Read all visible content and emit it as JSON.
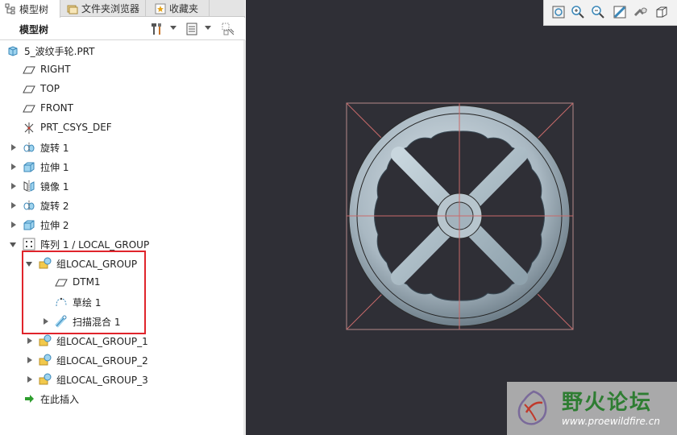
{
  "tabs": [
    {
      "label": "模型树",
      "icon": "model-tree-icon",
      "active": true
    },
    {
      "label": "文件夹浏览器",
      "icon": "folder-browser-icon",
      "active": false
    },
    {
      "label": "收藏夹",
      "icon": "favorites-icon",
      "active": false
    }
  ],
  "tree_header": {
    "title": "模型树",
    "tools": [
      "settings-icon",
      "show-icon",
      "filter-icon"
    ]
  },
  "tree": [
    {
      "label": "5_波纹手轮.PRT",
      "icon": "part-icon",
      "toggle": "none"
    },
    {
      "label": "RIGHT",
      "icon": "datum-plane-icon",
      "toggle": "none"
    },
    {
      "label": "TOP",
      "icon": "datum-plane-icon",
      "toggle": "none"
    },
    {
      "label": "FRONT",
      "icon": "datum-plane-icon",
      "toggle": "none"
    },
    {
      "label": "PRT_CSYS_DEF",
      "icon": "csys-icon",
      "toggle": "none"
    },
    {
      "label": "旋转 1",
      "icon": "revolve-icon",
      "toggle": "collapsed"
    },
    {
      "label": "拉伸 1",
      "icon": "extrude-icon",
      "toggle": "collapsed"
    },
    {
      "label": "镜像 1",
      "icon": "mirror-icon",
      "toggle": "collapsed"
    },
    {
      "label": "旋转 2",
      "icon": "revolve-icon",
      "toggle": "collapsed"
    },
    {
      "label": "拉伸 2",
      "icon": "extrude-icon",
      "toggle": "collapsed"
    },
    {
      "label": "阵列 1 / LOCAL_GROUP",
      "icon": "pattern-icon",
      "toggle": "expanded"
    },
    {
      "label": "组LOCAL_GROUP",
      "icon": "group-icon",
      "toggle": "expanded"
    },
    {
      "label": "DTM1",
      "icon": "datum-plane-icon",
      "toggle": "none"
    },
    {
      "label": "草绘 1",
      "icon": "sketch-icon",
      "toggle": "none"
    },
    {
      "label": "扫描混合 1",
      "icon": "sweep-blend-icon",
      "toggle": "collapsed"
    },
    {
      "label": "组LOCAL_GROUP_1",
      "icon": "group-icon",
      "toggle": "collapsed"
    },
    {
      "label": "组LOCAL_GROUP_2",
      "icon": "group-icon",
      "toggle": "collapsed"
    },
    {
      "label": "组LOCAL_GROUP_3",
      "icon": "group-icon",
      "toggle": "collapsed"
    },
    {
      "label": "在此插入",
      "icon": "insert-here-icon",
      "toggle": "none"
    }
  ],
  "view_toolbar": [
    "refit-icon",
    "zoom-in-icon",
    "zoom-out-icon",
    "repaint-icon",
    "display-style-icon",
    "saved-views-icon"
  ],
  "watermark": {
    "title": "野火论坛",
    "url": "www.proewildfire.cn"
  },
  "colors": {
    "graphics_bg": "#2f2f36",
    "highlight": "#e0242b",
    "model_fill": "#aab9c2",
    "datum_line": "#c86a6a"
  }
}
